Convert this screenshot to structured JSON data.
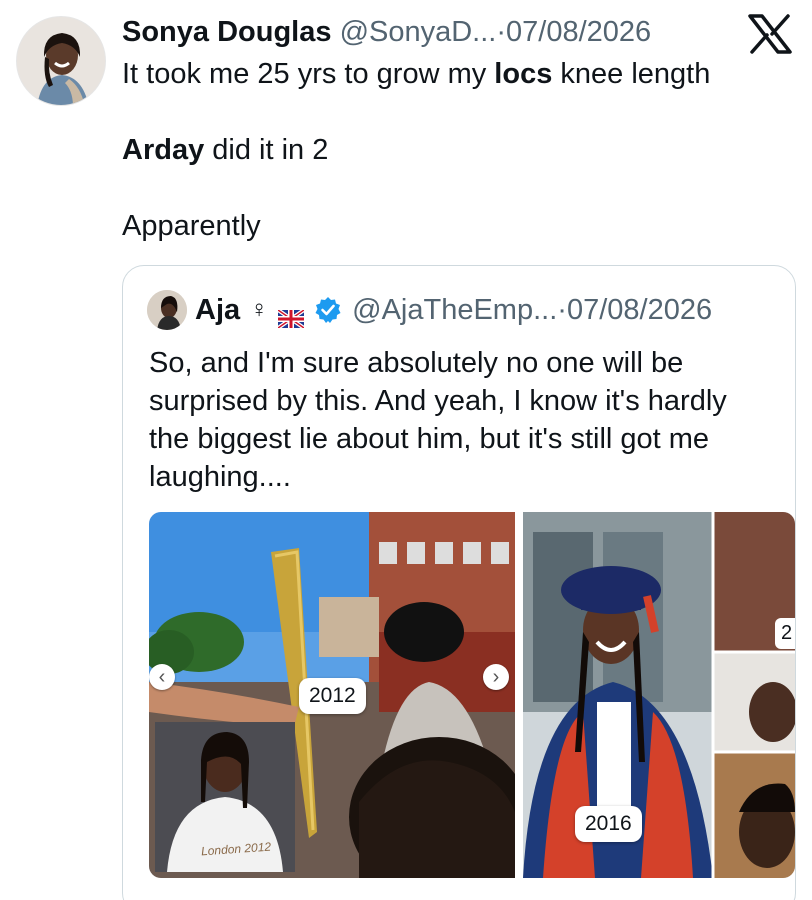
{
  "tweet": {
    "author_name": "Sonya Douglas",
    "author_handle": "@SonyaD...",
    "separator": "·",
    "date": "07/08/2026",
    "line1_pre": "It took me 25 yrs to grow my ",
    "line1_bold": "locs",
    "line1_post": " knee length",
    "line2_bold": "Arday",
    "line2_post": " did it in 2",
    "line3": "Apparently"
  },
  "quote": {
    "author_name": "Aja",
    "symbol": "♀",
    "handle": "@AjaTheEmp...",
    "separator": "·",
    "date": "07/08/2026",
    "text": "So, and I'm sure absolutely no one will be surprised by this. And yeah, I know it's hardly the biggest lie about him, but it's still got me laughing....",
    "media": {
      "left_badge": "2012",
      "inset_caption": "London 2012",
      "right_badge": "2016",
      "right_edge_badge": "2"
    }
  },
  "icons": {
    "platform": "x-logo-icon",
    "verified": "verified-badge-icon",
    "flag": "uk-flag-icon",
    "prev": "chevron-left-icon",
    "next": "chevron-right-icon"
  },
  "colors": {
    "text": "#0f1419",
    "muted": "#536471",
    "verified": "#1d9bf0",
    "border": "#cfd9de"
  }
}
